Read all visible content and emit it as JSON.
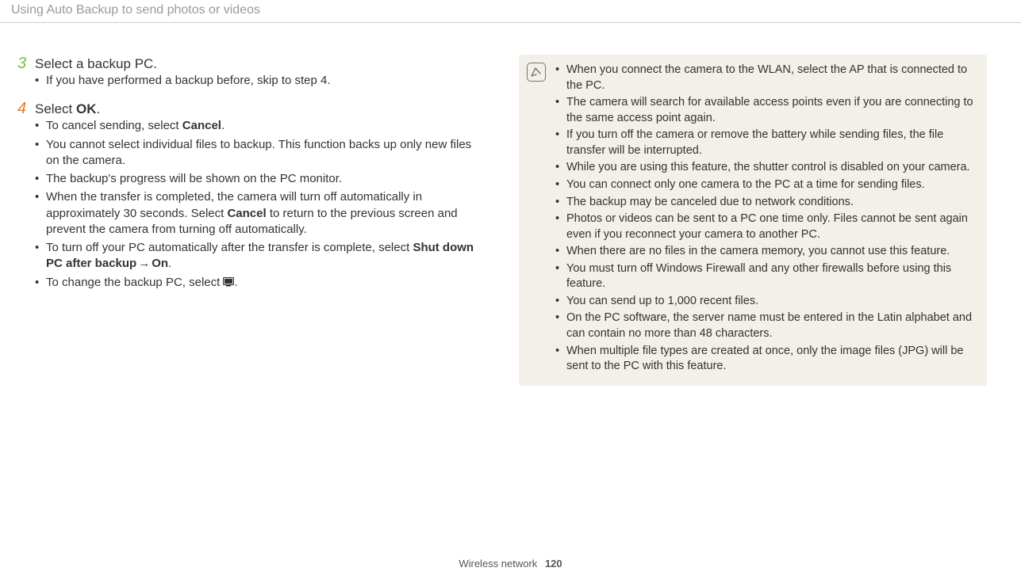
{
  "header": {
    "title": "Using Auto Backup to send photos or videos"
  },
  "steps": {
    "s3": {
      "num": "3",
      "head": "Select a backup PC.",
      "items": [
        {
          "text": "If you have performed a backup before, skip to step 4."
        }
      ]
    },
    "s4": {
      "num": "4",
      "head_pre": "Select ",
      "head_bold": "OK",
      "head_post": ".",
      "items": [
        {
          "pre": "To cancel sending, select ",
          "bold1": "Cancel",
          "post": "."
        },
        {
          "text": "You cannot select individual files to backup. This function backs up only new files on the camera."
        },
        {
          "text": "The backup's progress will be shown on the PC monitor."
        },
        {
          "pre": "When the transfer is completed, the camera will turn off automatically in approximately 30 seconds. Select ",
          "bold1": "Cancel",
          "post": " to return to the previous screen and prevent the camera from turning off automatically."
        },
        {
          "pre": "To turn off your PC automatically after the transfer is complete, select ",
          "bold1": "Shut down PC after backup",
          "arrow": " → ",
          "bold2": "On",
          "post": "."
        },
        {
          "pre": "To change the backup PC, select ",
          "icon": true,
          "post": "."
        }
      ]
    }
  },
  "notes": [
    "When you connect the camera to the WLAN, select the AP that is connected to the PC.",
    "The camera will search for available access points even if you are connecting to the same access point again.",
    "If you turn off the camera or remove the battery while sending files, the file transfer will be interrupted.",
    "While you are using this feature, the shutter control is disabled on your camera.",
    "You can connect only one camera to the PC at a time for sending files.",
    "The backup may be canceled due to network conditions.",
    "Photos or videos can be sent to a PC one time only. Files cannot be sent again even if you reconnect your camera to another PC.",
    "When there are no files in the camera memory, you cannot use this feature.",
    "You must turn off Windows Firewall and any other firewalls before using this feature.",
    "You can send up to 1,000 recent files.",
    "On the PC software, the server name must be entered in the Latin alphabet and can contain no more than 48 characters.",
    "When multiple file types are created at once, only the image files (JPG) will be sent to the PC with this feature."
  ],
  "footer": {
    "section": "Wireless network",
    "page": "120"
  }
}
